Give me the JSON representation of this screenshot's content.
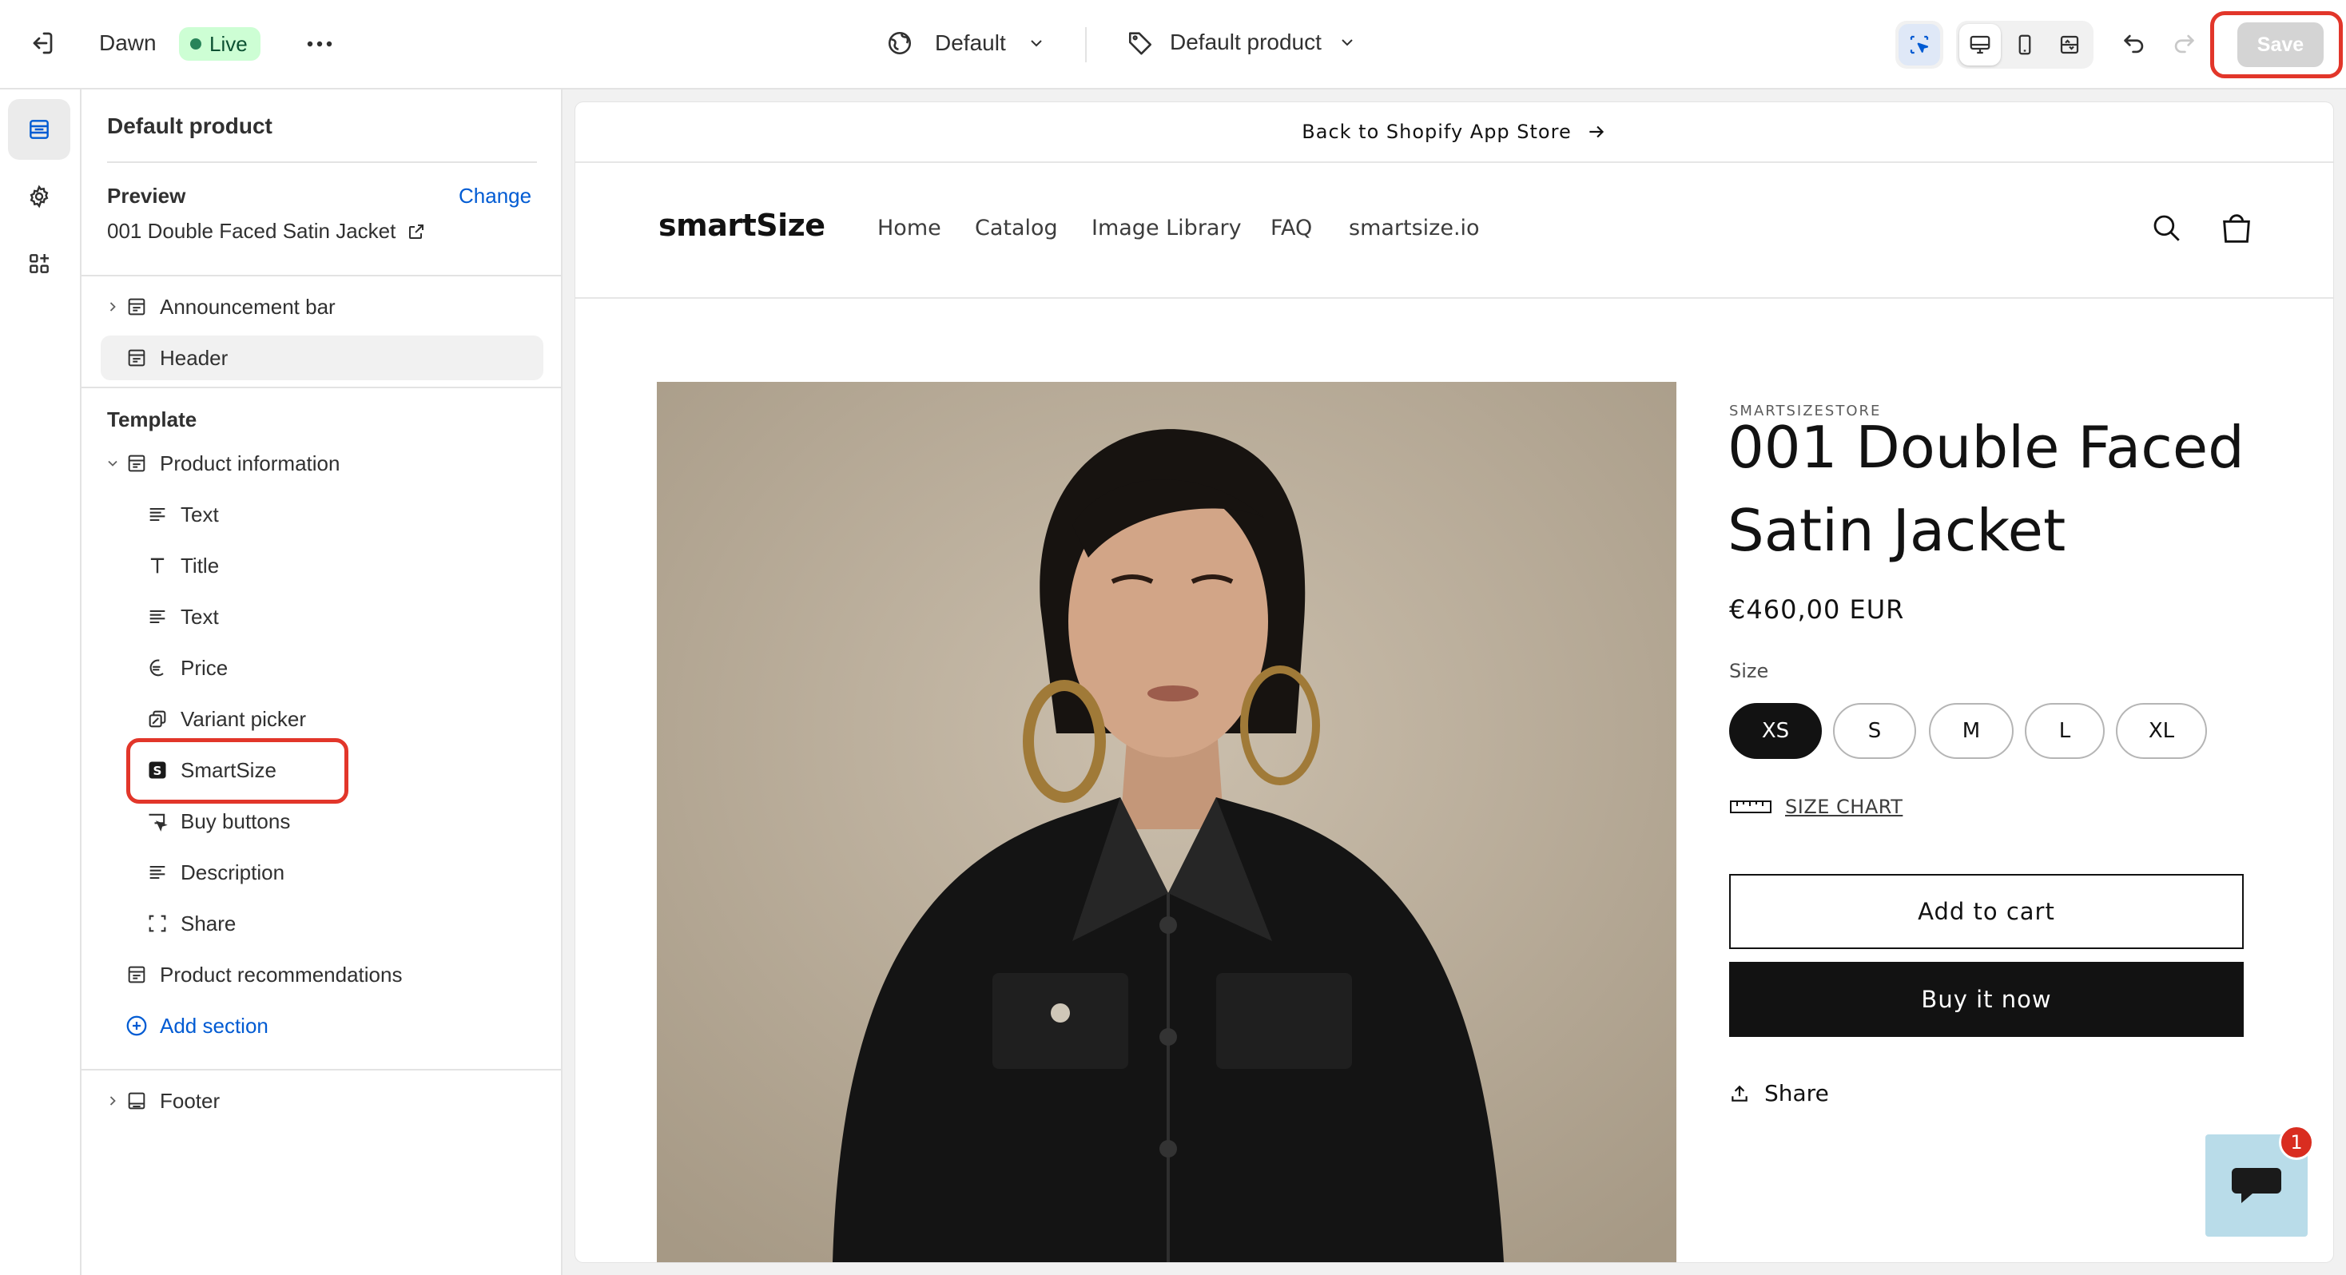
{
  "topbar": {
    "theme_name": "Dawn",
    "live_label": "Live",
    "locale_label": "Default",
    "template_label": "Default product",
    "save_label": "Save"
  },
  "sidebar": {
    "title": "Default product",
    "preview_label": "Preview",
    "change_label": "Change",
    "product_name": "001 Double Faced Satin Jacket",
    "header_group": [
      {
        "label": "Announcement bar"
      },
      {
        "label": "Header"
      }
    ],
    "template_label": "Template",
    "section_product_info": "Product information",
    "blocks": [
      {
        "label": "Text",
        "icon": "text-lines-icon"
      },
      {
        "label": "Title",
        "icon": "title-t-icon"
      },
      {
        "label": "Text",
        "icon": "text-lines-icon"
      },
      {
        "label": "Price",
        "icon": "price-tag-icon"
      },
      {
        "label": "Variant picker",
        "icon": "variant-icon"
      },
      {
        "label": "SmartSize",
        "icon": "smartsize-app-icon"
      },
      {
        "label": "Buy buttons",
        "icon": "cart-pointer-icon"
      },
      {
        "label": "Description",
        "icon": "text-lines-icon"
      },
      {
        "label": "Share",
        "icon": "share-frame-icon"
      }
    ],
    "section_recommendations": "Product recommendations",
    "add_section_label": "Add section",
    "footer_label": "Footer"
  },
  "store": {
    "announcement": "Back to Shopify App Store",
    "logo_text": "smartSize",
    "nav": [
      "Home",
      "Catalog",
      "Image Library",
      "FAQ",
      "smartsize.io"
    ],
    "vendor": "SMARTSIZESTORE",
    "product_title_line1": "001 Double Faced",
    "product_title_line2": "Satin Jacket",
    "price": "€460,00 EUR",
    "size_label": "Size",
    "sizes": [
      "XS",
      "S",
      "M",
      "L",
      "XL"
    ],
    "selected_size": "XS",
    "size_chart_label": "SIZE CHART",
    "add_to_cart_label": "Add to cart",
    "buy_now_label": "Buy it now",
    "share_label": "Share",
    "chat_badge_count": "1"
  },
  "colors": {
    "accent_blue": "#005bd3",
    "highlight_red": "#e2362a",
    "live_green": "#29845a",
    "buy_now_bg": "#121212",
    "chat_bg": "#b9dce9"
  }
}
